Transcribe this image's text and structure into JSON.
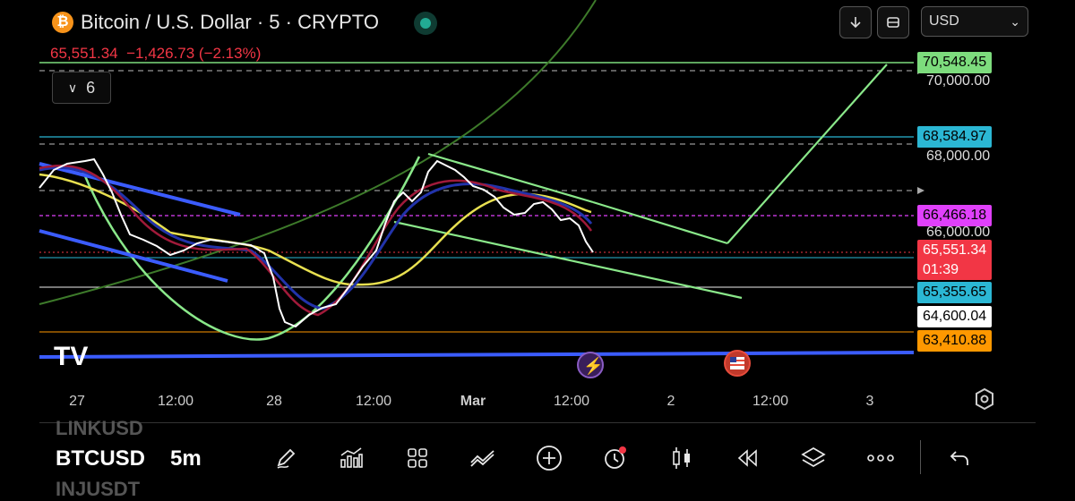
{
  "header": {
    "coin_icon": "bitcoin-icon",
    "title": "Bitcoin / U.S. Dollar · 5 · CRYPTO",
    "price": "65,551.34",
    "change": "−1,426.73 (−2.13%)",
    "currency": "USD",
    "indicators_count": "6"
  },
  "price_labels": {
    "l70548": "70,548.45",
    "l68584": "68,584.97",
    "l66466": "66,466.18",
    "l65551": "65,551.34",
    "countdown": "01:39",
    "l65355": "65,355.65",
    "l64600": "64,600.04",
    "l63410": "63,410.88"
  },
  "grid_labels": {
    "g70000": "70,000.00",
    "g68000": "68,000.00",
    "g66000": "66,000.00"
  },
  "time_axis": [
    "27",
    "12:00",
    "28",
    "12:00",
    "Mar",
    "12:00",
    "2",
    "12:00",
    "3"
  ],
  "watermark": "TV",
  "bottom": {
    "ticker_above": "LINKUSD",
    "ticker": "BTCUSD",
    "interval": "5m",
    "ticker_below": "INJUSDT"
  },
  "toolbar_icons": [
    "pen-icon",
    "indicators-icon",
    "grid-icon",
    "trend-icon",
    "add-icon",
    "alert-icon",
    "candles-icon",
    "replay-icon",
    "layers-icon",
    "more-icon",
    "undo-icon"
  ],
  "colors": {
    "up": "#22ab94",
    "down": "#f23645",
    "label_green": "#7ddc7d",
    "label_cyan": "#2bb7d4",
    "label_magenta": "#e040fb",
    "label_orange": "#ff9800",
    "trendline_blue": "#3b5cff"
  }
}
